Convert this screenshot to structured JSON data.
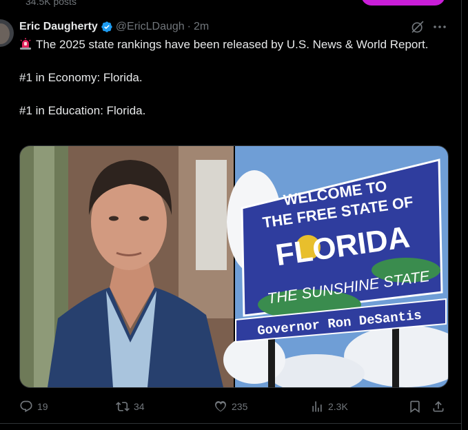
{
  "timeline": {
    "posts_count": "34.5K posts"
  },
  "tweet": {
    "author_name": "Eric Daugherty",
    "handle": "@EricLDaugh",
    "separator": "·",
    "time": "2m",
    "text_line1": "The 2025 state rankings have been released by U.S. News & World Report.",
    "text_line2": "#1 in Economy: Florida.",
    "text_line3": "#1 in Education: Florida.",
    "sign": {
      "line1": "WELCOME TO",
      "line2": "THE FREE STATE OF",
      "state": "FLORIDA",
      "motto": "THE SUNSHINE STATE",
      "governor": "Governor Ron DeSantis"
    },
    "stats": {
      "replies": "19",
      "reposts": "34",
      "likes": "235",
      "views": "2.3K"
    }
  },
  "colors": {
    "verified": "#1d9bf0",
    "sign_blue": "#2f3d9e",
    "accent_pill": "#c91ed8"
  },
  "icons": [
    "verified-badge-icon",
    "grok-icon",
    "more-icon",
    "siren-emoji-icon",
    "reply-icon",
    "repost-icon",
    "like-icon",
    "views-icon",
    "bookmark-icon",
    "share-icon"
  ]
}
